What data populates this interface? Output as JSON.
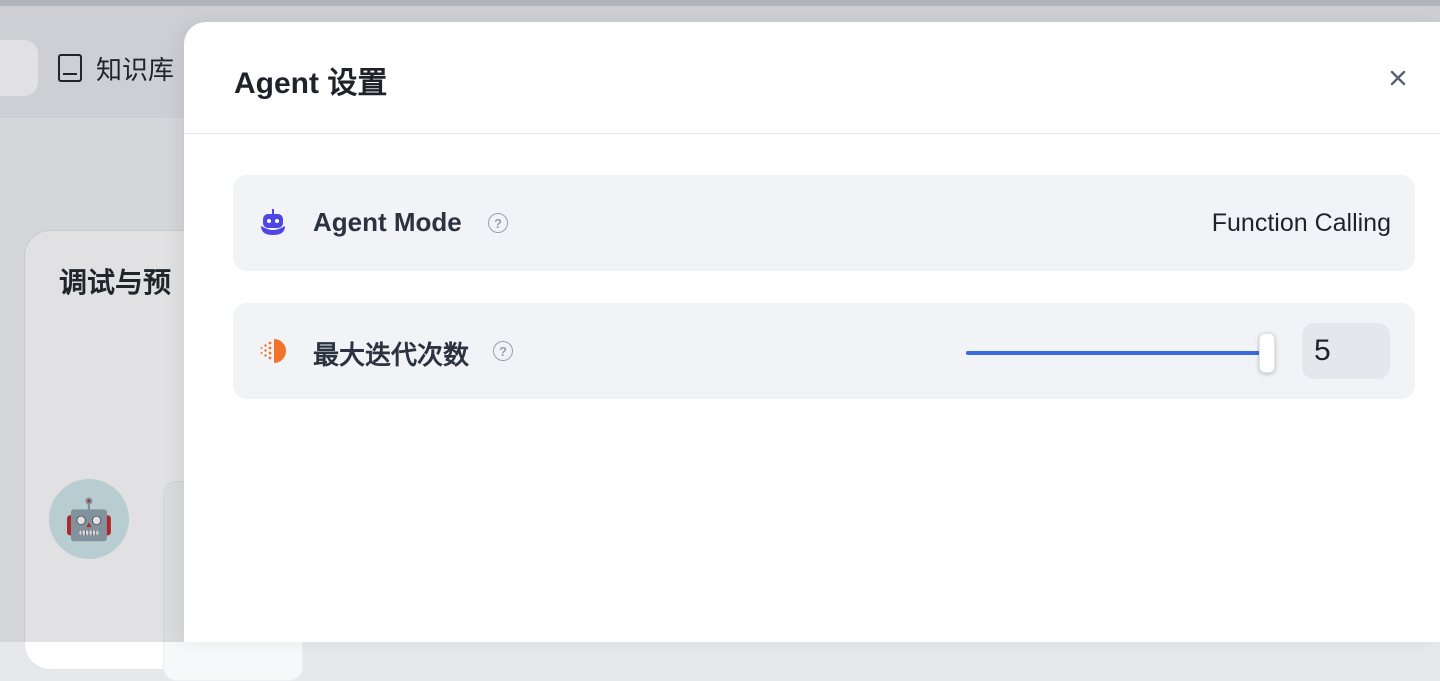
{
  "background": {
    "nav": {
      "knowledge_base_label": "知识库",
      "icon": "book-icon"
    },
    "card": {
      "title": "调试与预",
      "avatar_emoji": "🤖"
    }
  },
  "drawer": {
    "title": "Agent 设置",
    "close_icon": "close-icon",
    "settings": [
      {
        "key": "agent_mode",
        "label": "Agent Mode",
        "icon": "robot-icon",
        "help_icon": "question-circle-icon",
        "value": "Function Calling"
      },
      {
        "key": "max_iterations",
        "label": "最大迭代次数",
        "icon": "iteration-icon",
        "help_icon": "question-circle-icon",
        "slider_fraction": 1.0,
        "value": "5"
      }
    ]
  },
  "colors": {
    "accent": "#3b6be0",
    "robot_icon": "#4f46e5",
    "iteration_icon": "#f0742c"
  }
}
